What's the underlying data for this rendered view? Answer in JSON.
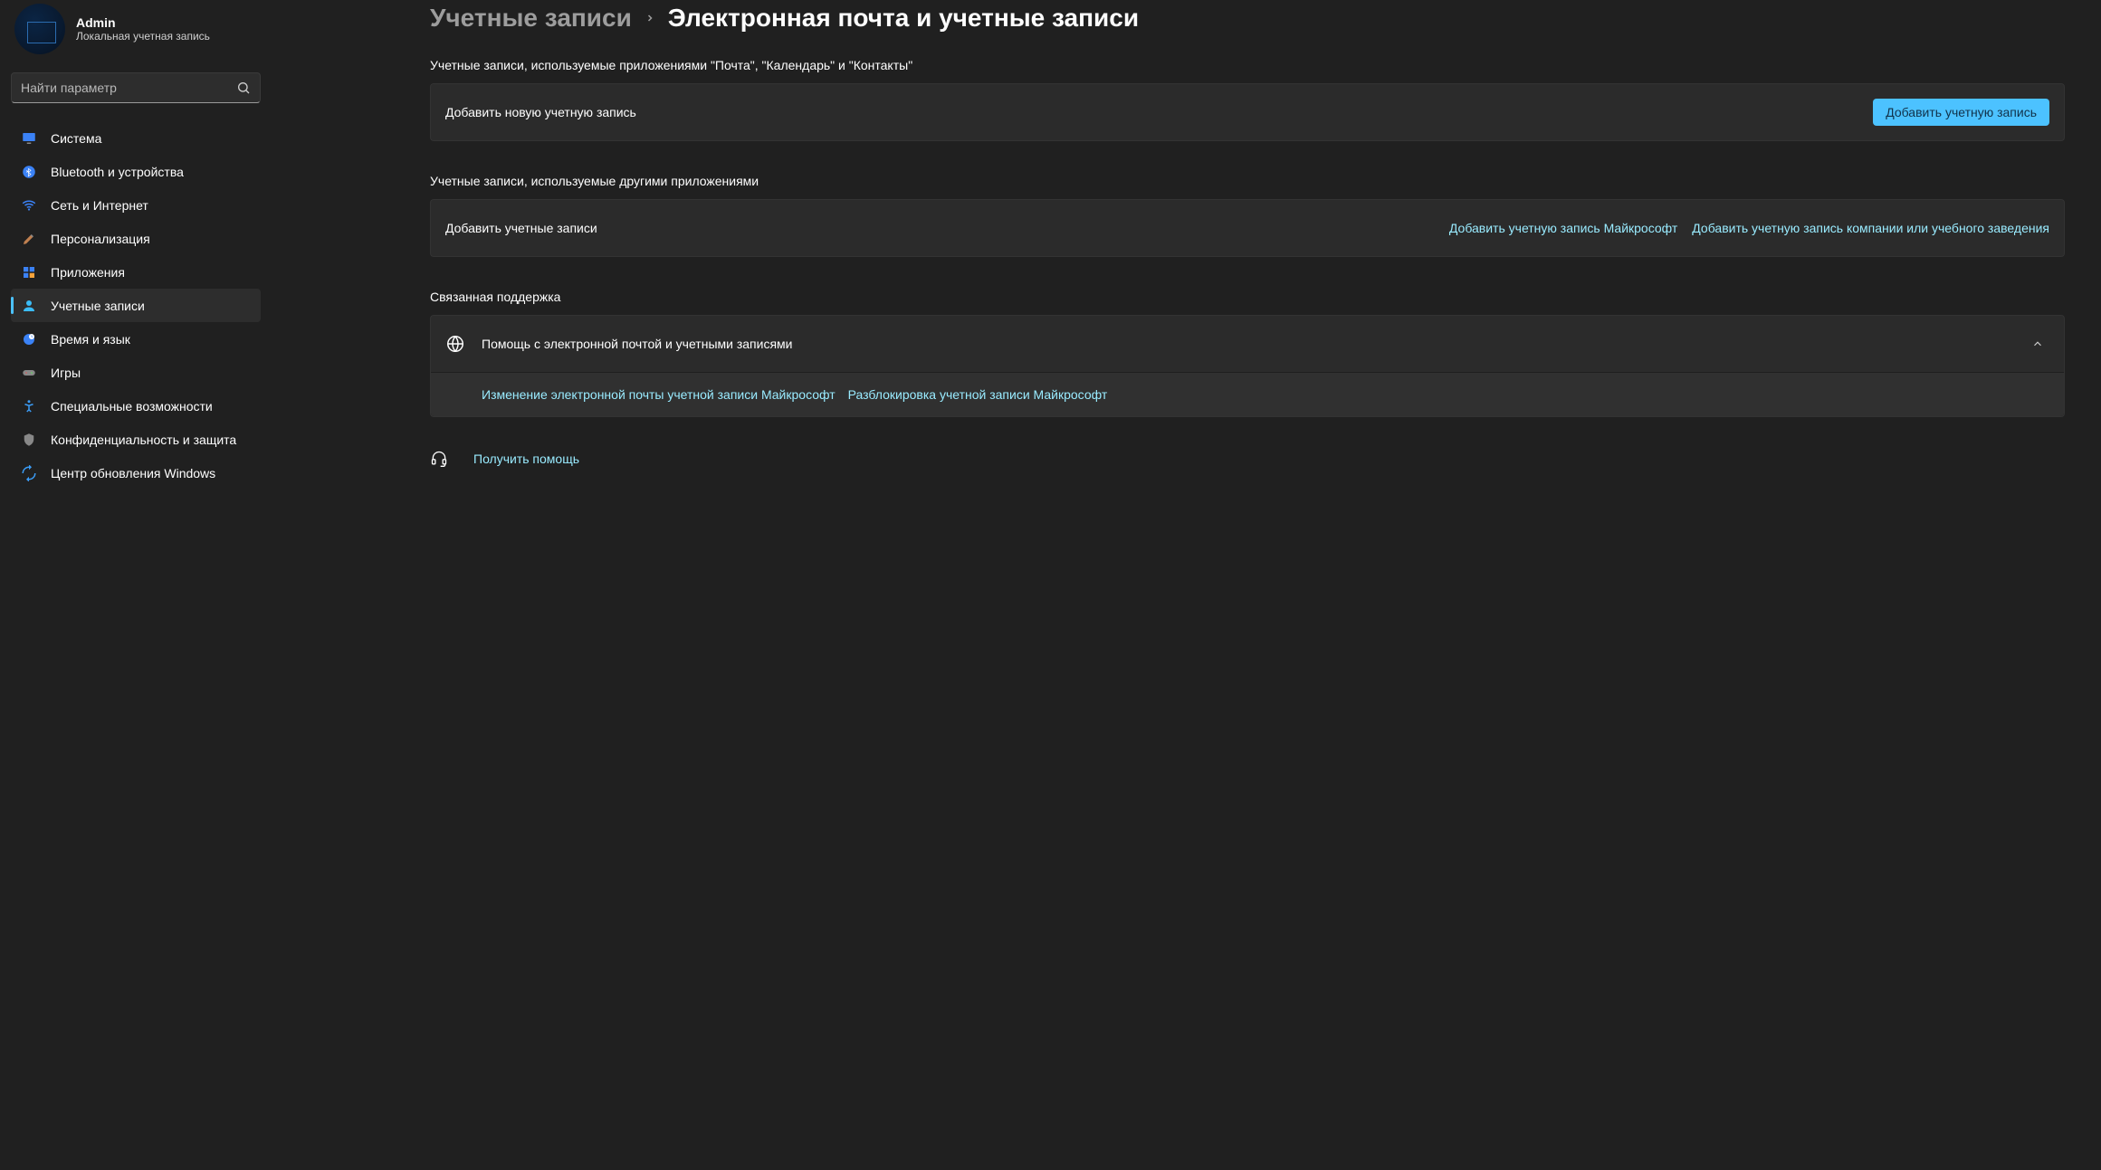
{
  "profile": {
    "name": "Admin",
    "subtitle": "Локальная учетная запись"
  },
  "search": {
    "placeholder": "Найти параметр"
  },
  "nav": {
    "items": [
      {
        "label": "Система"
      },
      {
        "label": "Bluetooth и устройства"
      },
      {
        "label": "Сеть и Интернет"
      },
      {
        "label": "Персонализация"
      },
      {
        "label": "Приложения"
      },
      {
        "label": "Учетные записи"
      },
      {
        "label": "Время и язык"
      },
      {
        "label": "Игры"
      },
      {
        "label": "Специальные возможности"
      },
      {
        "label": "Конфиденциальность и защита"
      },
      {
        "label": "Центр обновления Windows"
      }
    ]
  },
  "breadcrumb": {
    "parent": "Учетные записи",
    "current": "Электронная почта и учетные записи"
  },
  "section1": {
    "title": "Учетные записи, используемые приложениями \"Почта\", \"Календарь\" и \"Контакты\"",
    "row_label": "Добавить новую учетную запись",
    "button": "Добавить учетную запись"
  },
  "section2": {
    "title": "Учетные записи, используемые другими приложениями",
    "row_label": "Добавить учетные записи",
    "link_ms": "Добавить учетную запись Майкрософт",
    "link_work": "Добавить учетную запись компании или учебного заведения"
  },
  "section3": {
    "title": "Связанная поддержка",
    "header": "Помощь с электронной почтой и учетными записями",
    "link1": "Изменение электронной почты учетной записи Майкрософт",
    "link2": "Разблокировка учетной записи Майкрософт"
  },
  "help": {
    "label": "Получить помощь"
  }
}
